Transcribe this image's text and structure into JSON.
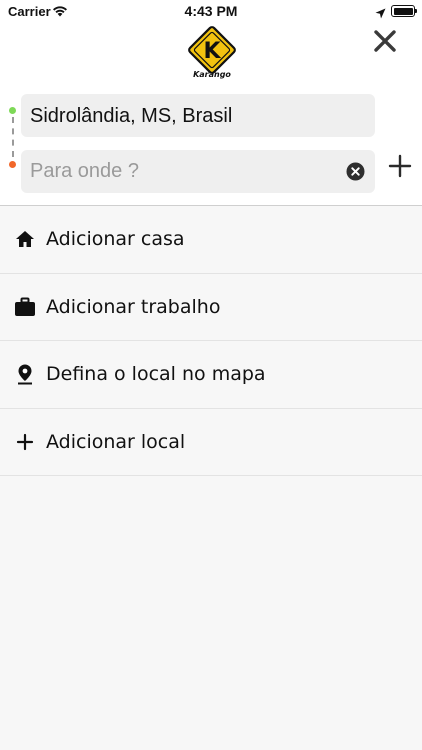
{
  "status_bar": {
    "carrier": "Carrier",
    "time": "4:43 PM"
  },
  "header": {
    "logo_letter": "K",
    "logo_caption": "Karango",
    "close_icon": "close-x-icon"
  },
  "route": {
    "origin": {
      "value": "Sidrolândia, MS, Brasil",
      "dot_color": "#7ed957"
    },
    "destination": {
      "value": "",
      "placeholder": "Para onde ?",
      "dot_color": "#f1672a"
    },
    "add_stop_icon": "plus-icon"
  },
  "places": [
    {
      "icon": "home-icon",
      "label": "Adicionar casa"
    },
    {
      "icon": "briefcase-icon",
      "label": "Adicionar trabalho"
    },
    {
      "icon": "location-pin-icon",
      "label": "Defina o local no mapa"
    },
    {
      "icon": "plus-icon",
      "label": "Adicionar local"
    }
  ],
  "colors": {
    "logo_yellow": "#f2c20f",
    "background": "#f7f7f7",
    "field_background": "#efefef"
  }
}
